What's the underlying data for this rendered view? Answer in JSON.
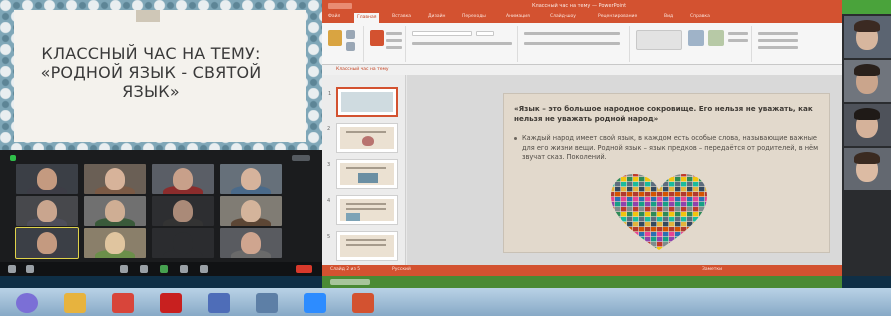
{
  "title_slide": {
    "title": "КЛАССНЫЙ ЧАС НА ТЕМУ: «РОДНОЙ ЯЗЫК - СВЯТОЙ ЯЗЫК»"
  },
  "powerpoint": {
    "window_title": "Классный час на тему — PowerPoint",
    "tabs": [
      {
        "label": "Файл"
      },
      {
        "label": "Главная"
      },
      {
        "label": "Вставка"
      },
      {
        "label": "Дизайн"
      },
      {
        "label": "Переходы"
      },
      {
        "label": "Анимация"
      },
      {
        "label": "Слайд-шоу"
      },
      {
        "label": "Рецензирование"
      },
      {
        "label": "Вид"
      },
      {
        "label": "Справка"
      }
    ],
    "active_tab": "Главная",
    "pane_title": "Классный час на тему",
    "slides": [
      {
        "number": "1"
      },
      {
        "number": "2"
      },
      {
        "number": "3"
      },
      {
        "number": "4"
      },
      {
        "number": "5"
      }
    ],
    "current_slide": {
      "heading": "«Язык – это большое народное сокровище. Его нельзя не уважать, как нельзя не уважать родной народ»",
      "body": "Каждый народ имеет свой язык, в каждом есть особые слова, называющие важные для его жизни вещи. Родной язык – язык предков – передаётся от родителей, в нём звучат сказ. Поколений."
    },
    "status": {
      "slide_counter": "Слайд 2 из 5",
      "language": "Русский",
      "zoom": "Заметки"
    }
  },
  "zoom_gallery": {
    "participants": [
      {
        "name": "",
        "skin": "#c49a80",
        "shirt": "#3d3d46",
        "bg": "#3b3f46"
      },
      {
        "name": "",
        "skin": "#d7b39a",
        "shirt": "#7b5a45",
        "bg": "#6a5f55"
      },
      {
        "name": "",
        "skin": "#c8a08a",
        "shirt": "#8b2c2c",
        "bg": "#5a5e66"
      },
      {
        "name": "",
        "skin": "#d6b39c",
        "shirt": "#4a6a8a",
        "bg": "#66707a"
      },
      {
        "name": "",
        "skin": "#c9a58e",
        "shirt": "#4e4e5a",
        "bg": "#47484c"
      },
      {
        "name": "",
        "skin": "#cfae94",
        "shirt": "#3a5a3a",
        "bg": "#707070"
      },
      {
        "name": "",
        "skin": "#aa8a78",
        "shirt": "#333333",
        "bg": "#2d2e31"
      },
      {
        "name": "",
        "skin": "#d4b49b",
        "shirt": "#5c4635",
        "bg": "#807c74"
      },
      {
        "name": "",
        "skin": "#c49a80",
        "shirt": "#3d3d46",
        "bg": "#3b3f46"
      },
      {
        "name": "",
        "skin": "#e0c59f",
        "shirt": "#6b8f4a",
        "bg": "#8a7f6a"
      },
      {
        "name": "",
        "skin": "#2b2c2f",
        "shirt": "#2b2c2f",
        "bg": "#2b2c2f"
      },
      {
        "name": "",
        "skin": "#cfa58f",
        "shirt": "#6a6a6a",
        "bg": "#595b60"
      }
    ]
  },
  "taskbar": {
    "apps": [
      {
        "icon": "start-orb-icon",
        "color": "#7b6fd6"
      },
      {
        "icon": "folder-icon",
        "color": "#e7b33e"
      },
      {
        "icon": "chrome-icon",
        "color": "#d8453a"
      },
      {
        "icon": "acrobat-icon",
        "color": "#c8201f"
      },
      {
        "icon": "flag-icon",
        "color": "#4e6db8"
      },
      {
        "icon": "media-icon",
        "color": "#5d7fa6"
      },
      {
        "icon": "zoom-icon",
        "color": "#2d8cff"
      },
      {
        "icon": "powerpoint-icon",
        "color": "#d35230"
      }
    ]
  }
}
